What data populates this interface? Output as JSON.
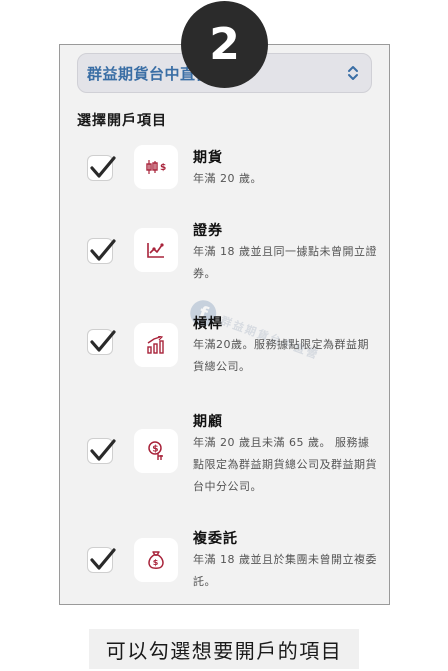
{
  "step_number": "2",
  "broker_select": {
    "value": "群益期貨台中直營"
  },
  "section_title": "選擇開戶項目",
  "items": [
    {
      "title": "期貨",
      "desc": "年滿 20 歲。",
      "checked": true,
      "icon": "candlestick-icon"
    },
    {
      "title": "證券",
      "desc": "年滿 18 歲並且同一據點未曾開立證券。",
      "checked": true,
      "icon": "stock-chart-icon"
    },
    {
      "title": "槓桿",
      "desc": "年滿20歲。服務據點限定為群益期貨總公司。",
      "checked": true,
      "icon": "bar-growth-icon"
    },
    {
      "title": "期顧",
      "desc": "年滿 20 歲且未滿 65 歲。 服務據點限定為群益期貨總公司及群益期貨台中分公司。",
      "checked": true,
      "icon": "advisor-hand-icon"
    },
    {
      "title": "複委託",
      "desc": "年滿 18 歲並且於集團未曾開立複委託。",
      "checked": true,
      "icon": "money-bag-icon"
    }
  ],
  "watermark_text": "群益期貨台中直營",
  "caption": "可以勾選想要開戶的項目",
  "colors": {
    "accent": "#a8233a",
    "link": "#3a6ea5"
  }
}
